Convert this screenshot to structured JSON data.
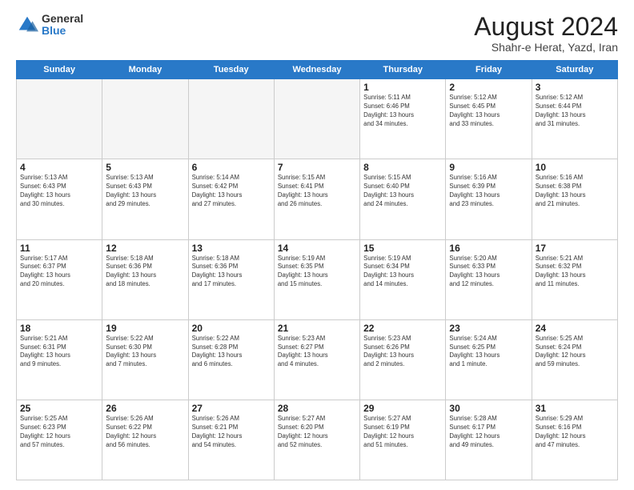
{
  "logo": {
    "general": "General",
    "blue": "Blue"
  },
  "header": {
    "month": "August 2024",
    "location": "Shahr-e Herat, Yazd, Iran"
  },
  "weekdays": [
    "Sunday",
    "Monday",
    "Tuesday",
    "Wednesday",
    "Thursday",
    "Friday",
    "Saturday"
  ],
  "weeks": [
    [
      {
        "day": "",
        "info": ""
      },
      {
        "day": "",
        "info": ""
      },
      {
        "day": "",
        "info": ""
      },
      {
        "day": "",
        "info": ""
      },
      {
        "day": "1",
        "info": "Sunrise: 5:11 AM\nSunset: 6:46 PM\nDaylight: 13 hours\nand 34 minutes."
      },
      {
        "day": "2",
        "info": "Sunrise: 5:12 AM\nSunset: 6:45 PM\nDaylight: 13 hours\nand 33 minutes."
      },
      {
        "day": "3",
        "info": "Sunrise: 5:12 AM\nSunset: 6:44 PM\nDaylight: 13 hours\nand 31 minutes."
      }
    ],
    [
      {
        "day": "4",
        "info": "Sunrise: 5:13 AM\nSunset: 6:43 PM\nDaylight: 13 hours\nand 30 minutes."
      },
      {
        "day": "5",
        "info": "Sunrise: 5:13 AM\nSunset: 6:43 PM\nDaylight: 13 hours\nand 29 minutes."
      },
      {
        "day": "6",
        "info": "Sunrise: 5:14 AM\nSunset: 6:42 PM\nDaylight: 13 hours\nand 27 minutes."
      },
      {
        "day": "7",
        "info": "Sunrise: 5:15 AM\nSunset: 6:41 PM\nDaylight: 13 hours\nand 26 minutes."
      },
      {
        "day": "8",
        "info": "Sunrise: 5:15 AM\nSunset: 6:40 PM\nDaylight: 13 hours\nand 24 minutes."
      },
      {
        "day": "9",
        "info": "Sunrise: 5:16 AM\nSunset: 6:39 PM\nDaylight: 13 hours\nand 23 minutes."
      },
      {
        "day": "10",
        "info": "Sunrise: 5:16 AM\nSunset: 6:38 PM\nDaylight: 13 hours\nand 21 minutes."
      }
    ],
    [
      {
        "day": "11",
        "info": "Sunrise: 5:17 AM\nSunset: 6:37 PM\nDaylight: 13 hours\nand 20 minutes."
      },
      {
        "day": "12",
        "info": "Sunrise: 5:18 AM\nSunset: 6:36 PM\nDaylight: 13 hours\nand 18 minutes."
      },
      {
        "day": "13",
        "info": "Sunrise: 5:18 AM\nSunset: 6:36 PM\nDaylight: 13 hours\nand 17 minutes."
      },
      {
        "day": "14",
        "info": "Sunrise: 5:19 AM\nSunset: 6:35 PM\nDaylight: 13 hours\nand 15 minutes."
      },
      {
        "day": "15",
        "info": "Sunrise: 5:19 AM\nSunset: 6:34 PM\nDaylight: 13 hours\nand 14 minutes."
      },
      {
        "day": "16",
        "info": "Sunrise: 5:20 AM\nSunset: 6:33 PM\nDaylight: 13 hours\nand 12 minutes."
      },
      {
        "day": "17",
        "info": "Sunrise: 5:21 AM\nSunset: 6:32 PM\nDaylight: 13 hours\nand 11 minutes."
      }
    ],
    [
      {
        "day": "18",
        "info": "Sunrise: 5:21 AM\nSunset: 6:31 PM\nDaylight: 13 hours\nand 9 minutes."
      },
      {
        "day": "19",
        "info": "Sunrise: 5:22 AM\nSunset: 6:30 PM\nDaylight: 13 hours\nand 7 minutes."
      },
      {
        "day": "20",
        "info": "Sunrise: 5:22 AM\nSunset: 6:28 PM\nDaylight: 13 hours\nand 6 minutes."
      },
      {
        "day": "21",
        "info": "Sunrise: 5:23 AM\nSunset: 6:27 PM\nDaylight: 13 hours\nand 4 minutes."
      },
      {
        "day": "22",
        "info": "Sunrise: 5:23 AM\nSunset: 6:26 PM\nDaylight: 13 hours\nand 2 minutes."
      },
      {
        "day": "23",
        "info": "Sunrise: 5:24 AM\nSunset: 6:25 PM\nDaylight: 13 hours\nand 1 minute."
      },
      {
        "day": "24",
        "info": "Sunrise: 5:25 AM\nSunset: 6:24 PM\nDaylight: 12 hours\nand 59 minutes."
      }
    ],
    [
      {
        "day": "25",
        "info": "Sunrise: 5:25 AM\nSunset: 6:23 PM\nDaylight: 12 hours\nand 57 minutes."
      },
      {
        "day": "26",
        "info": "Sunrise: 5:26 AM\nSunset: 6:22 PM\nDaylight: 12 hours\nand 56 minutes."
      },
      {
        "day": "27",
        "info": "Sunrise: 5:26 AM\nSunset: 6:21 PM\nDaylight: 12 hours\nand 54 minutes."
      },
      {
        "day": "28",
        "info": "Sunrise: 5:27 AM\nSunset: 6:20 PM\nDaylight: 12 hours\nand 52 minutes."
      },
      {
        "day": "29",
        "info": "Sunrise: 5:27 AM\nSunset: 6:19 PM\nDaylight: 12 hours\nand 51 minutes."
      },
      {
        "day": "30",
        "info": "Sunrise: 5:28 AM\nSunset: 6:17 PM\nDaylight: 12 hours\nand 49 minutes."
      },
      {
        "day": "31",
        "info": "Sunrise: 5:29 AM\nSunset: 6:16 PM\nDaylight: 12 hours\nand 47 minutes."
      }
    ]
  ]
}
